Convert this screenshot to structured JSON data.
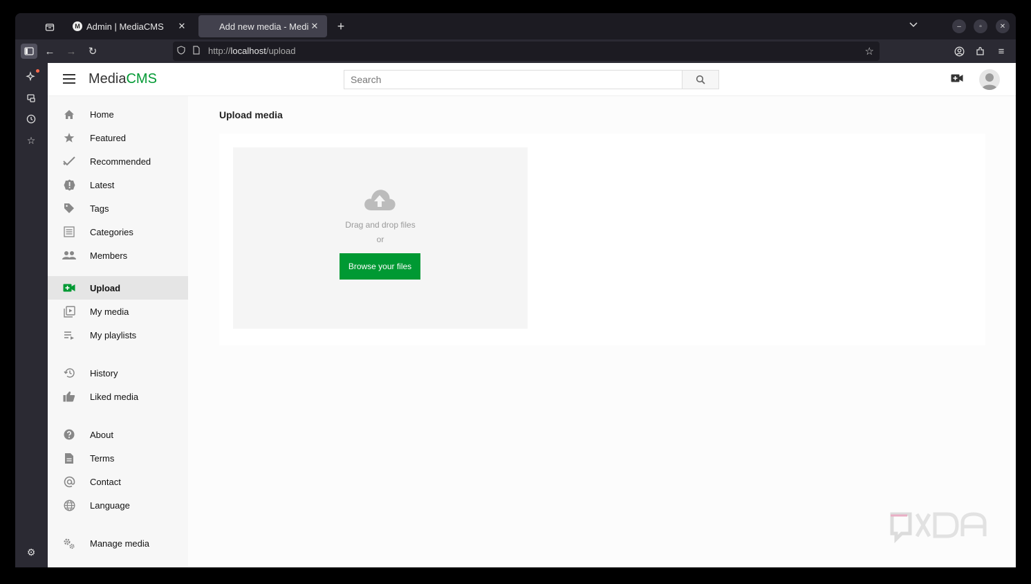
{
  "browser": {
    "tabs": [
      {
        "label": "Admin | MediaCMS",
        "favicon": "M"
      },
      {
        "label": "Add new media - MediaCMS",
        "favicon": ""
      }
    ],
    "url_scheme": "http://",
    "url_host": "localhost",
    "url_path": "/upload"
  },
  "app": {
    "logo_main": "Media",
    "logo_accent": "CMS",
    "search_placeholder": "Search",
    "accent_color": "#009933"
  },
  "nav": {
    "items": [
      {
        "label": "Home",
        "icon": "home-icon"
      },
      {
        "label": "Featured",
        "icon": "star-icon"
      },
      {
        "label": "Recommended",
        "icon": "check-icon"
      },
      {
        "label": "Latest",
        "icon": "alert-badge-icon"
      },
      {
        "label": "Tags",
        "icon": "tag-icon"
      },
      {
        "label": "Categories",
        "icon": "list-icon"
      },
      {
        "label": "Members",
        "icon": "people-icon"
      },
      {
        "label": "Upload",
        "icon": "video-add-icon",
        "active": true
      },
      {
        "label": "My media",
        "icon": "media-library-icon"
      },
      {
        "label": "My playlists",
        "icon": "playlist-icon"
      },
      {
        "label": "History",
        "icon": "history-icon"
      },
      {
        "label": "Liked media",
        "icon": "thumb-up-icon"
      },
      {
        "label": "About",
        "icon": "help-icon"
      },
      {
        "label": "Terms",
        "icon": "document-icon"
      },
      {
        "label": "Contact",
        "icon": "at-icon"
      },
      {
        "label": "Language",
        "icon": "globe-icon"
      },
      {
        "label": "Manage media",
        "icon": "gears-icon"
      }
    ]
  },
  "main": {
    "title": "Upload media",
    "drag_text": "Drag and drop files",
    "or_text": "or",
    "browse_label": "Browse your files"
  }
}
